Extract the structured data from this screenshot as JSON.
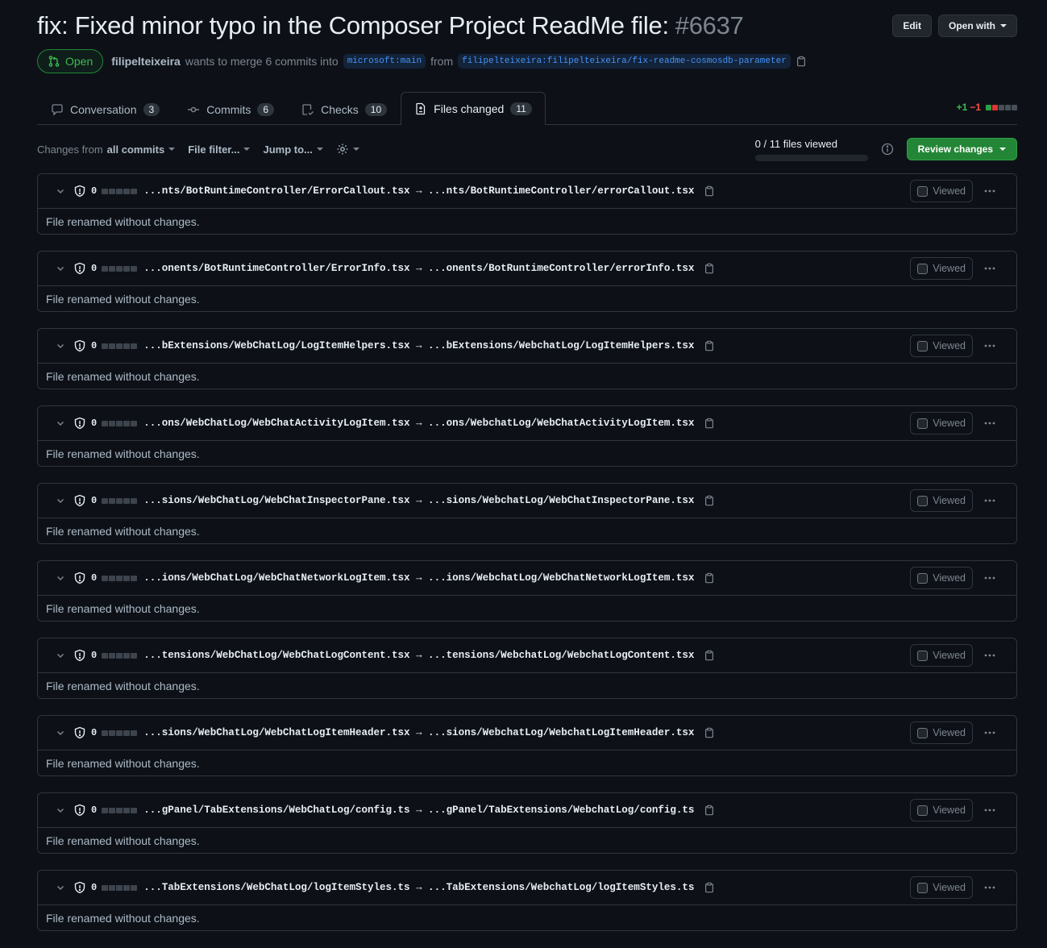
{
  "pr": {
    "title": "fix: Fixed minor typo in the Composer Project ReadMe file:",
    "number": "#6637",
    "state": "Open",
    "author": "filipelteixeira",
    "merge_text": "wants to merge 6 commits into",
    "base_branch": "microsoft:main",
    "from_text": "from",
    "head_branch": "filipelteixeira:filipelteixeira/fix-readme-cosmosdb-parameter"
  },
  "header": {
    "edit_label": "Edit",
    "open_with_label": "Open with"
  },
  "tabs": [
    {
      "label": "Conversation",
      "count": "3",
      "icon": "comment-icon"
    },
    {
      "label": "Commits",
      "count": "6",
      "icon": "commit-icon"
    },
    {
      "label": "Checks",
      "count": "10",
      "icon": "checklist-icon"
    },
    {
      "label": "Files changed",
      "count": "11",
      "icon": "file-diff-icon"
    }
  ],
  "diffstat": {
    "additions": "+1",
    "deletions": "−1"
  },
  "toolbar": {
    "changes_from_prefix": "Changes from",
    "changes_from_value": "all commits",
    "file_filter": "File filter...",
    "jump_to": "Jump to...",
    "files_viewed": "0 / 11 files viewed",
    "review_changes": "Review changes"
  },
  "file_common": {
    "count": "0",
    "viewed_label": "Viewed",
    "body": "File renamed without changes."
  },
  "files": [
    {
      "path": "...nts/BotRuntimeController/ErrorCallout.tsx → ...nts/BotRuntimeController/errorCallout.tsx"
    },
    {
      "path": "...onents/BotRuntimeController/ErrorInfo.tsx → ...onents/BotRuntimeController/errorInfo.tsx"
    },
    {
      "path": "...bExtensions/WebChatLog/LogItemHelpers.tsx → ...bExtensions/WebchatLog/LogItemHelpers.tsx"
    },
    {
      "path": "...ons/WebChatLog/WebChatActivityLogItem.tsx → ...ons/WebchatLog/WebChatActivityLogItem.tsx"
    },
    {
      "path": "...sions/WebChatLog/WebChatInspectorPane.tsx → ...sions/WebchatLog/WebChatInspectorPane.tsx"
    },
    {
      "path": "...ions/WebChatLog/WebChatNetworkLogItem.tsx → ...ions/WebchatLog/WebChatNetworkLogItem.tsx"
    },
    {
      "path": "...tensions/WebChatLog/WebChatLogContent.tsx → ...tensions/WebchatLog/WebchatLogContent.tsx"
    },
    {
      "path": "...sions/WebChatLog/WebChatLogItemHeader.tsx → ...sions/WebchatLog/WebchatLogItemHeader.tsx"
    },
    {
      "path": "...gPanel/TabExtensions/WebChatLog/config.ts → ...gPanel/TabExtensions/WebchatLog/config.ts"
    },
    {
      "path": "...TabExtensions/WebChatLog/logItemStyles.ts → ...TabExtensions/WebchatLog/logItemStyles.ts"
    }
  ]
}
